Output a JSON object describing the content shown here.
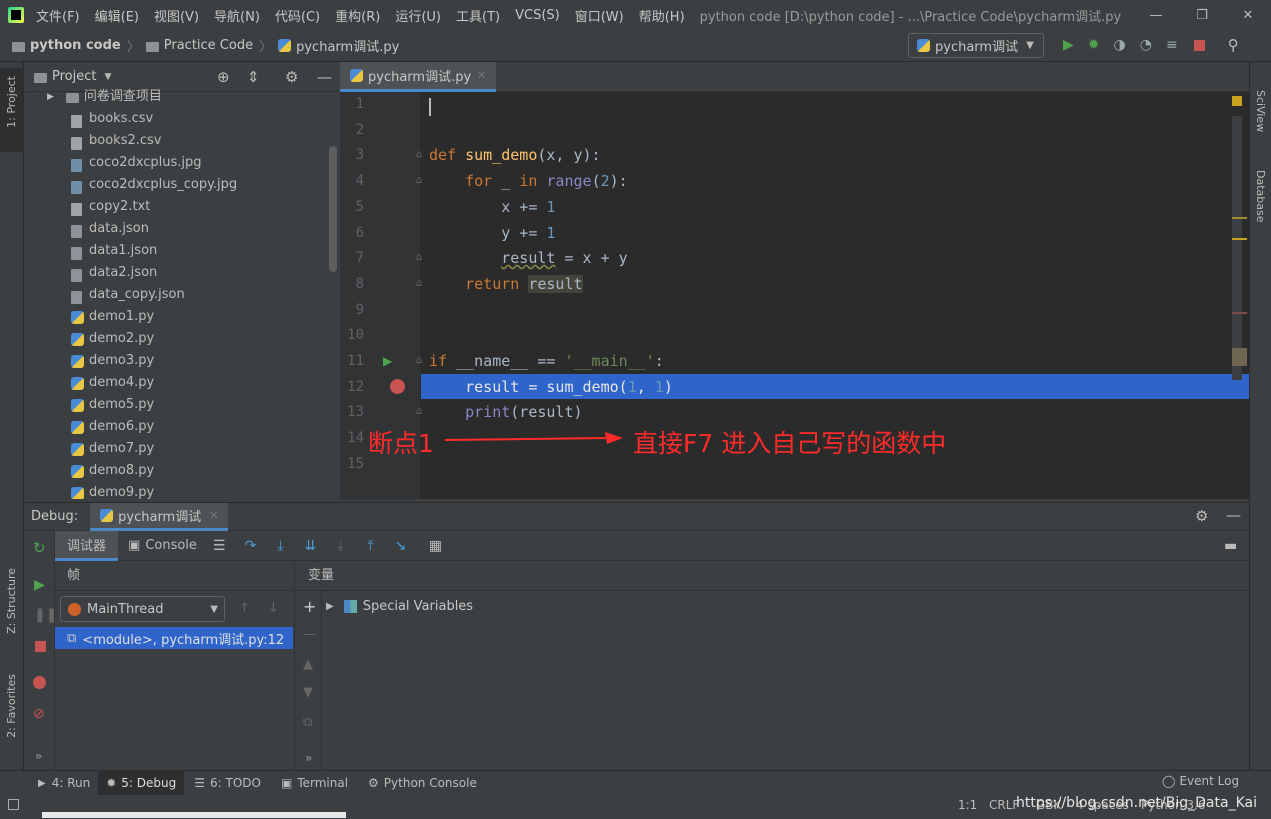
{
  "menubar": {
    "items": [
      "文件(F)",
      "编辑(E)",
      "视图(V)",
      "导航(N)",
      "代码(C)",
      "重构(R)",
      "运行(U)",
      "工具(T)",
      "VCS(S)",
      "窗口(W)",
      "帮助(H)"
    ],
    "title": "python code [D:\\python code] - ...\\Practice Code\\pycharm调试.py"
  },
  "nav": {
    "crumbs": [
      "python code",
      "Practice Code",
      "pycharm调试.py"
    ],
    "run_config": "pycharm调试"
  },
  "left_tools": {
    "project": "1: Project",
    "structure": "Z: Structure",
    "favorites": "2: Favorites"
  },
  "right_tools": {
    "sciview": "SciView",
    "database": "Database"
  },
  "project": {
    "title": "Project",
    "items": [
      {
        "name": "问卷调查项目",
        "type": "folder"
      },
      {
        "name": "books.csv",
        "type": "file"
      },
      {
        "name": "books2.csv",
        "type": "file"
      },
      {
        "name": "coco2dxcplus.jpg",
        "type": "img"
      },
      {
        "name": "coco2dxcplus_copy.jpg",
        "type": "img"
      },
      {
        "name": "copy2.txt",
        "type": "file"
      },
      {
        "name": "data.json",
        "type": "json"
      },
      {
        "name": "data1.json",
        "type": "json"
      },
      {
        "name": "data2.json",
        "type": "json"
      },
      {
        "name": "data_copy.json",
        "type": "json"
      },
      {
        "name": "demo1.py",
        "type": "py"
      },
      {
        "name": "demo2.py",
        "type": "py"
      },
      {
        "name": "demo3.py",
        "type": "py"
      },
      {
        "name": "demo4.py",
        "type": "py"
      },
      {
        "name": "demo5.py",
        "type": "py"
      },
      {
        "name": "demo6.py",
        "type": "py"
      },
      {
        "name": "demo7.py",
        "type": "py"
      },
      {
        "name": "demo8.py",
        "type": "py"
      },
      {
        "name": "demo9.py",
        "type": "py"
      }
    ]
  },
  "editor": {
    "tab": "pycharm调试.py",
    "line_numbers": [
      "1",
      "2",
      "3",
      "4",
      "5",
      "6",
      "7",
      "8",
      "9",
      "10",
      "11",
      "12",
      "13",
      "14",
      "15"
    ],
    "annotation_left": "断点1",
    "annotation_right": "直接F7 进入自己写的函数中"
  },
  "debug": {
    "label": "Debug:",
    "session": "pycharm调试",
    "tab_debugger": "调试器",
    "tab_console": "Console",
    "frames_label": "帧",
    "variables_label": "变量",
    "thread": "MainThread",
    "frame": "<module>, pycharm调试.py:12",
    "special_vars": "Special Variables"
  },
  "bottom_tabs": [
    "4: Run",
    "5: Debug",
    "6: TODO",
    "Terminal",
    "Python Console"
  ],
  "event_log": "Event Log",
  "status": {
    "position": "1:1",
    "line_sep": "CRLF",
    "encoding": "GBK",
    "indent": "4 spaces",
    "interpreter": "Python 3.6",
    "watermark": "https://blog.csdn.net/Big_Data_Kai"
  },
  "colors": {
    "accent": "#4a88c7",
    "selection": "#2f65ca",
    "breakpoint": "#c75450",
    "annotation": "#ff2a2a",
    "run": "#4fa34f"
  }
}
